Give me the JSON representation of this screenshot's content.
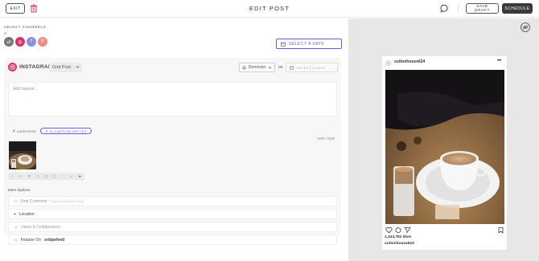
{
  "header": {
    "exit_label": "EXIT",
    "title": "EDIT POST",
    "save_draft_label": "SAVE\nDRAFT",
    "schedule_label": "SCHEDULE",
    "icons": [
      "trash-icon",
      "chat-icon"
    ]
  },
  "channels": {
    "label": "SELECT CHANNELS",
    "count": "4/",
    "items": [
      {
        "name": "all-channels",
        "color": "#777777",
        "glyph": "⇄"
      },
      {
        "name": "instagram",
        "color": "#d6336c",
        "glyph": "◎"
      },
      {
        "name": "facebook",
        "color": "#8f8fe0",
        "glyph": "f"
      },
      {
        "name": "pinterest",
        "color": "#f08a8a",
        "glyph": "P"
      }
    ],
    "select_date_label": "SELECT A DATE"
  },
  "editor": {
    "network": "INSTAGRAM",
    "post_type": "Grid Post",
    "reminder_label": "Reminder",
    "on_label": "on",
    "date_placeholder": "SELECT A DATE",
    "caption_placeholder": "Add caption...",
    "hashtags_label": "HASHTAGS",
    "ai_writer_label": "AI CAPTION WRITER",
    "char_count": "2200 / 2200",
    "media_tools": [
      "+",
      "✂",
      "⌗",
      "▢",
      "◫",
      "◯",
      "⬚",
      "◐",
      "●"
    ]
  },
  "more_options": {
    "label": "More Options",
    "rows": [
      {
        "label": "First Comment",
        "hint": "Turn to Auto Post To Use"
      },
      {
        "label": "Location",
        "hint": ""
      },
      {
        "label": "Users & Collaborators",
        "hint": ""
      },
      {
        "label": "Feature On",
        "value": "sridpefeed"
      }
    ]
  },
  "preview": {
    "username": "suttonhouse624",
    "likes": "1,344,762 likes",
    "caption_user": "suttonhouse624",
    "avatar_letter": "S"
  },
  "colors": {
    "accent": "#6b5bd2",
    "instagram": "#d6336c",
    "schedule_button": "#3a3a3a",
    "preview_bg": "#e7e7e7"
  }
}
